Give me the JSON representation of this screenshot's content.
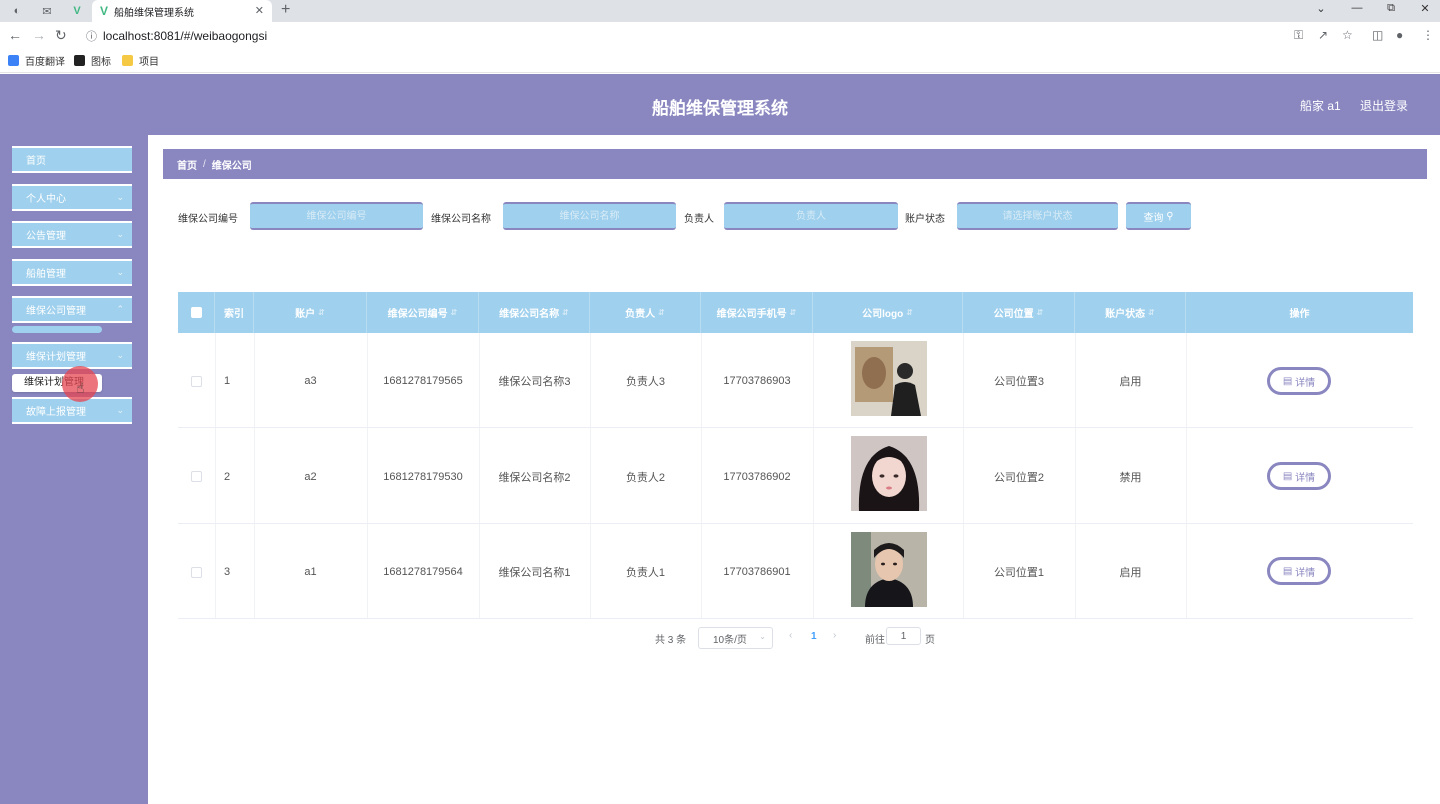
{
  "browser": {
    "tab_title": "船舶维保管理系统",
    "url": "localhost:8081/#/weibaogongsi",
    "bookmarks": [
      "百度翻译",
      "图标",
      "项目"
    ]
  },
  "header": {
    "title": "船舶维保管理系统",
    "user": "船家 a1",
    "logout": "退出登录"
  },
  "sidebar": {
    "items": [
      {
        "label": "首页",
        "has_children": false
      },
      {
        "label": "个人中心",
        "has_children": true
      },
      {
        "label": "公告管理",
        "has_children": true
      },
      {
        "label": "船舶管理",
        "has_children": true
      },
      {
        "label": "维保公司管理",
        "has_children": true
      },
      {
        "label": "维保计划管理",
        "has_children": true
      },
      {
        "label": "故障上报管理",
        "has_children": true
      }
    ],
    "tooltip": "维保计划管理"
  },
  "breadcrumb": {
    "home": "首页",
    "current": "维保公司"
  },
  "search": {
    "fields": [
      {
        "label": "维保公司编号",
        "placeholder": "维保公司编号"
      },
      {
        "label": "维保公司名称",
        "placeholder": "维保公司名称"
      },
      {
        "label": "负责人",
        "placeholder": "负责人"
      },
      {
        "label": "账户状态",
        "placeholder": "请选择账户状态"
      }
    ],
    "button": "查询"
  },
  "table": {
    "columns": [
      "索引",
      "账户",
      "维保公司编号",
      "维保公司名称",
      "负责人",
      "维保公司手机号",
      "公司logo",
      "公司位置",
      "账户状态",
      "操作"
    ],
    "rows": [
      {
        "index": "1",
        "account": "a3",
        "code": "1681278179565",
        "name": "维保公司名称3",
        "manager": "负责人3",
        "phone": "17703786903",
        "location": "公司位置3",
        "status": "启用",
        "action": "详情"
      },
      {
        "index": "2",
        "account": "a2",
        "code": "1681278179530",
        "name": "维保公司名称2",
        "manager": "负责人2",
        "phone": "17703786902",
        "location": "公司位置2",
        "status": "禁用",
        "action": "详情"
      },
      {
        "index": "3",
        "account": "a1",
        "code": "1681278179564",
        "name": "维保公司名称1",
        "manager": "负责人1",
        "phone": "17703786901",
        "location": "公司位置1",
        "status": "启用",
        "action": "详情"
      }
    ]
  },
  "pagination": {
    "total": "共 3 条",
    "page_size": "10条/页",
    "current_page": "1",
    "goto_label": "前往",
    "goto_value": "1",
    "page_suffix": "页"
  },
  "colors": {
    "primary": "#8a87c0",
    "accent": "#9fd0ed",
    "active_page": "#409eff"
  }
}
